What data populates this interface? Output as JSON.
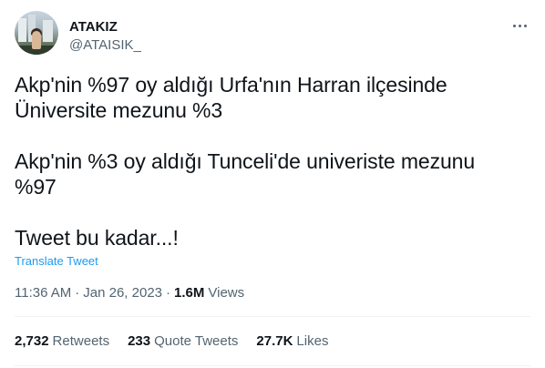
{
  "author": {
    "display_name": "ATAKIZ",
    "handle": "@ATAISIK_"
  },
  "tweet": {
    "text": "Akp'nin %97 oy aldığı Urfa'nın Harran ilçesinde\nÜniversite mezunu %3\n\nAkp'nin %3 oy aldığı Tunceli'de univeriste mezunu\n%97\n\nTweet bu kadar...!",
    "translate_label": "Translate Tweet",
    "time": "11:36 AM",
    "separator": "·",
    "date": "Jan 26, 2023",
    "views_count": "1.6M",
    "views_label": "Views"
  },
  "stats": {
    "retweets_count": "2,732",
    "retweets_label": "Retweets",
    "quotes_count": "233",
    "quotes_label": "Quote Tweets",
    "likes_count": "27.7K",
    "likes_label": "Likes"
  },
  "icons": {
    "more": "more-horizontal-icon"
  },
  "colors": {
    "text": "#0f1419",
    "secondary": "#536471",
    "link": "#1d9bf0",
    "divider": "#eff3f4"
  }
}
